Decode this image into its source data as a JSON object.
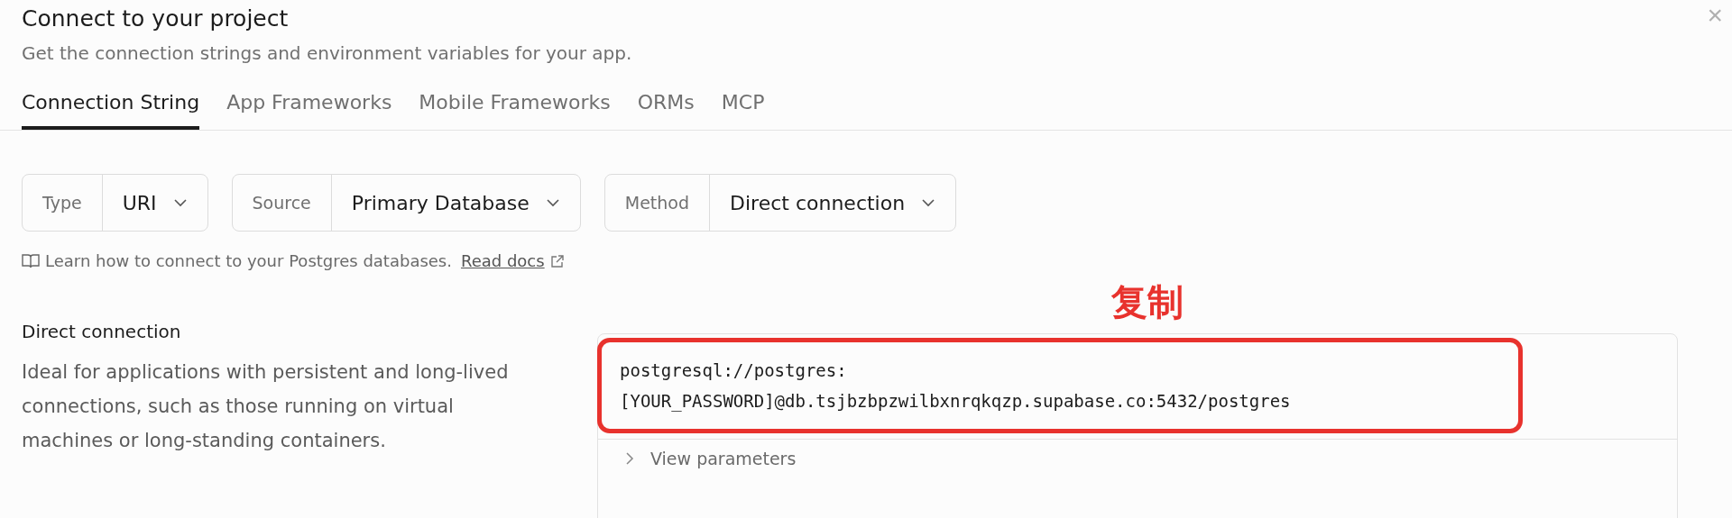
{
  "dialog": {
    "title": "Connect to your project",
    "subtitle": "Get the connection strings and environment variables for your app.",
    "close": "×"
  },
  "tabs": [
    {
      "label": "Connection String",
      "selected": true
    },
    {
      "label": "App Frameworks",
      "selected": false
    },
    {
      "label": "Mobile Frameworks",
      "selected": false
    },
    {
      "label": "ORMs",
      "selected": false
    },
    {
      "label": "MCP",
      "selected": false
    }
  ],
  "selectors": [
    {
      "label": "Type",
      "value": "URI"
    },
    {
      "label": "Source",
      "value": "Primary Database"
    },
    {
      "label": "Method",
      "value": "Direct connection"
    }
  ],
  "help": {
    "text": "Learn how to connect to your Postgres databases.",
    "link": "Read docs"
  },
  "annotation": "复制",
  "connection": {
    "title": "Direct connection",
    "description": "Ideal for applications with persistent and long-lived connections, such as those running on virtual machines or long-standing containers.",
    "code_lines": [
      "postgresql://postgres:",
      "[YOUR_PASSWORD]@db.tsjbzbpzwilbxnrqkqzp.supabase.co:5432/postgres"
    ],
    "parameters": "View parameters"
  }
}
